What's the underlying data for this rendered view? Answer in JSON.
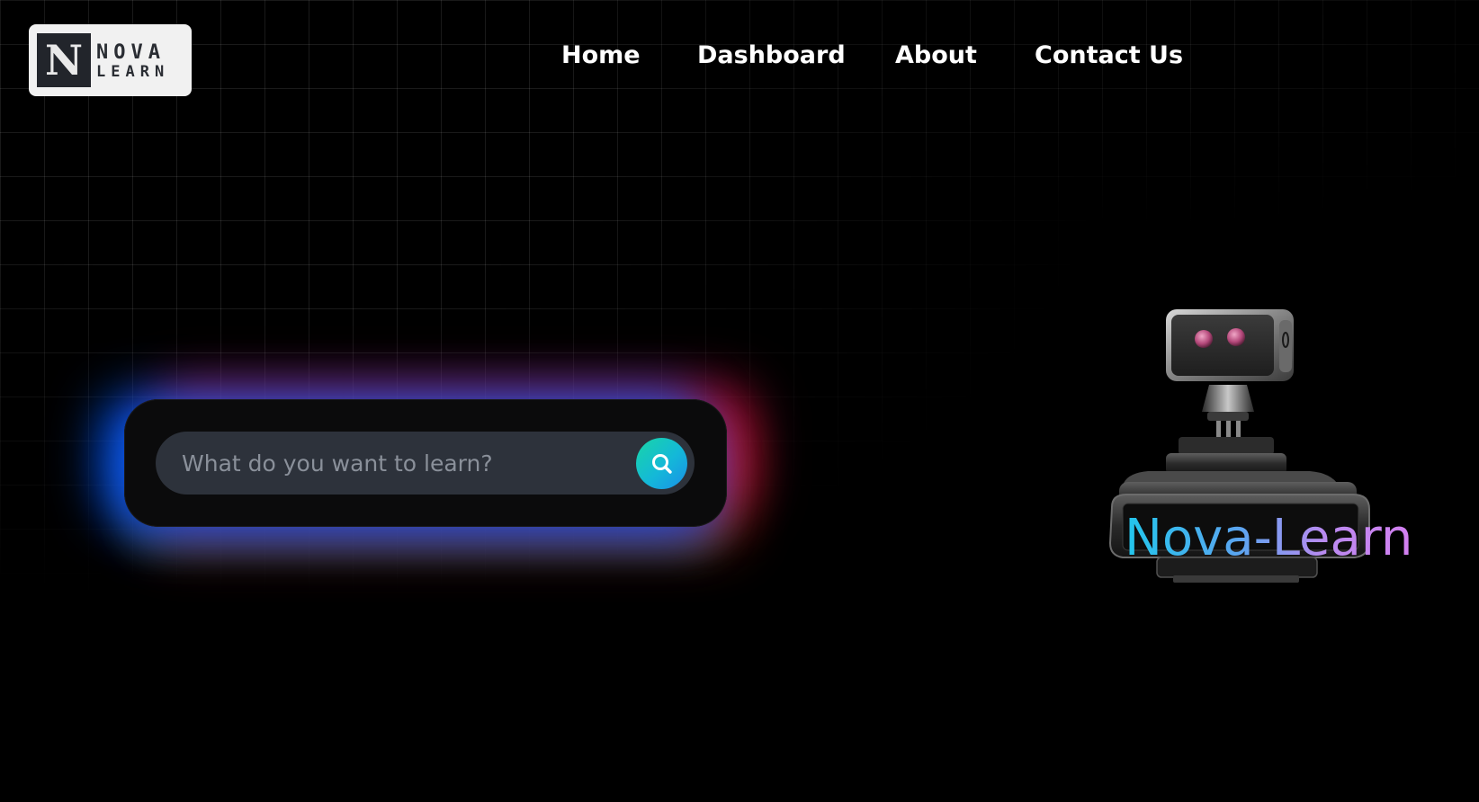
{
  "brand": {
    "logo_letter": "N",
    "logo_line1": "NOVA",
    "logo_line2": "LEARN"
  },
  "nav": {
    "items": [
      {
        "label": "Home"
      },
      {
        "label": "Dashboard"
      },
      {
        "label": "About"
      },
      {
        "label": "Contact Us"
      }
    ]
  },
  "search": {
    "placeholder": "What do you want to learn?",
    "value": "",
    "button_icon": "search-icon"
  },
  "hero": {
    "robot_icon": "robot-illustration",
    "robot_label": "Nova-Learn"
  },
  "colors": {
    "background": "#000000",
    "search_button_gradient_start": "#19d6a6",
    "search_button_gradient_end": "#1a8fe8",
    "glow_blue": "#005cff",
    "glow_red": "#dc1446",
    "label_gradient_start": "#22c6ec",
    "label_gradient_end": "#d27ff0"
  }
}
